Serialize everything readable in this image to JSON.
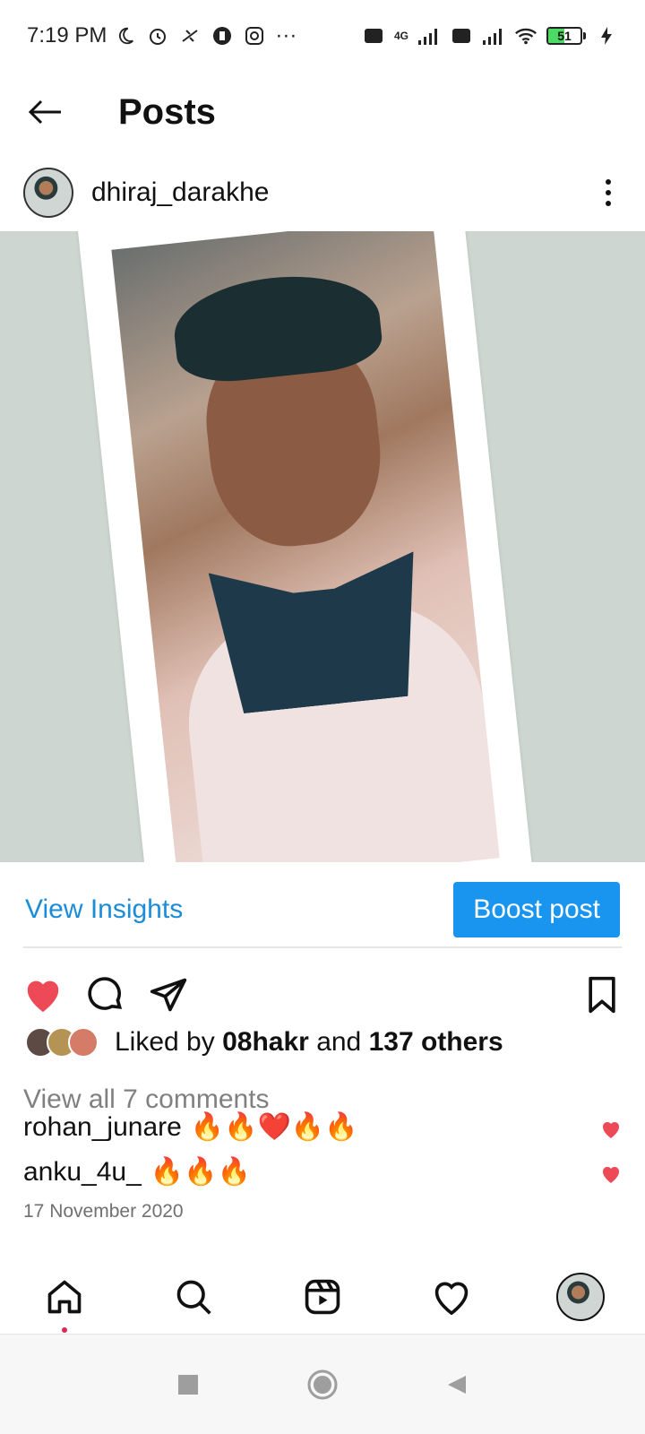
{
  "status_bar": {
    "time": "7:19 PM",
    "network_label": "4G",
    "battery_percent": 51,
    "icons_left": [
      "moon-icon",
      "alarm-icon",
      "network-icon",
      "app-icon",
      "instagram-icon"
    ],
    "more": "···"
  },
  "header": {
    "title": "Posts"
  },
  "post": {
    "username": "dhiraj_darakhe",
    "view_insights": "View Insights",
    "boost_post": "Boost post",
    "likes": {
      "prefix": "Liked by",
      "user": "08hakr",
      "connector": "and",
      "others": "137 others"
    },
    "view_comments": "View all 7 comments",
    "comments": [
      {
        "user": "rohan_junare",
        "text": "🔥🔥❤️🔥🔥"
      },
      {
        "user": "anku_4u_",
        "text": "🔥🔥🔥"
      }
    ],
    "date": "17 November 2020"
  },
  "colors": {
    "accent": "#1a95ef",
    "link": "#1a8cd8",
    "heart": "#ed4956"
  }
}
